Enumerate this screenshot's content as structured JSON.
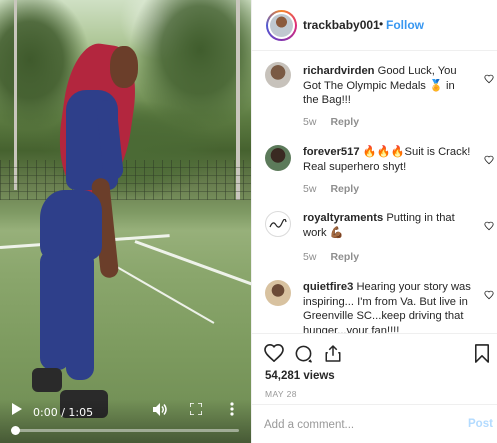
{
  "post": {
    "author": "trackbaby001",
    "separator": "•",
    "follow_label": "Follow"
  },
  "video": {
    "current_time": "0:00",
    "duration": "1:05",
    "time_display": "0:00 / 1:05",
    "progress": 0.0,
    "icons": [
      "play-icon",
      "volume-icon",
      "fullscreen-icon",
      "more-vertical-icon"
    ]
  },
  "comments": [
    {
      "user": "richardvirden",
      "text": "Good Luck, You Got The Olympic Medals 🏅 in the Bag!!!",
      "age": "5w",
      "reply_label": "Reply"
    },
    {
      "user": "forever517",
      "text": "🔥🔥🔥Suit is Crack! Real superhero shyt!",
      "age": "5w",
      "reply_label": "Reply"
    },
    {
      "user": "royaltyraments",
      "text": "Putting in that work 💪🏾",
      "age": "5w",
      "reply_label": "Reply"
    },
    {
      "user": "quietfire3",
      "text": "Hearing your story was inspiring... I'm from Va. But live in Greenville SC...keep driving that hunger...your fan!!!!",
      "age": "",
      "reply_label": ""
    }
  ],
  "stats": {
    "views": "54,281 views",
    "date": "MAY 28"
  },
  "composer": {
    "placeholder": "Add a comment...",
    "post_label": "Post"
  },
  "colors": {
    "accent": "#3897f0",
    "post_disabled": "#b3dbff",
    "suit": "#2e3f8a",
    "hair": "#b3263e"
  }
}
